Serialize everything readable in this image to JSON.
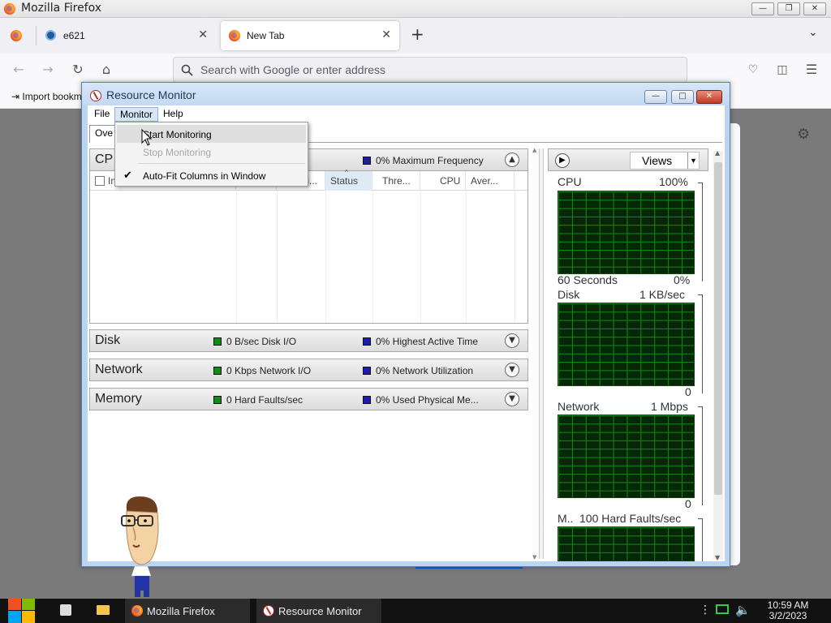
{
  "firefox": {
    "window_title": "Mozilla Firefox",
    "tabs": [
      {
        "label": "e621"
      },
      {
        "label": "New Tab"
      }
    ],
    "new_tab_symbol": "+",
    "url_placeholder": "Search with Google or enter address",
    "bookmark_label": "Import bookm"
  },
  "resource_monitor": {
    "title": "Resource Monitor",
    "menu": {
      "file": "File",
      "monitor": "Monitor",
      "help": "Help"
    },
    "tab_partial": "Ove",
    "dropdown": {
      "start": "Start Monitoring",
      "stop": "Stop Monitoring",
      "autofit": "Auto-Fit Columns in Window"
    },
    "cpu_section": {
      "name": "CP",
      "metric2": "0% Maximum Frequency",
      "columns": [
        "Ima",
        "PI",
        "Descri...",
        "Status",
        "Thre...",
        "CPU",
        "Aver..."
      ]
    },
    "sections": [
      {
        "name": "Disk",
        "metric1": "0 B/sec Disk I/O",
        "metric2": "0% Highest Active Time"
      },
      {
        "name": "Network",
        "metric1": "0 Kbps Network I/O",
        "metric2": "0% Network Utilization"
      },
      {
        "name": "Memory",
        "metric1": "0 Hard Faults/sec",
        "metric2": "0% Used Physical Me..."
      }
    ],
    "views_label": "Views",
    "graphs": [
      {
        "name": "CPU",
        "max": "100%",
        "time": "60 Seconds",
        "min": "0%"
      },
      {
        "name": "Disk",
        "max": "1 KB/sec",
        "min": "0"
      },
      {
        "name": "Network",
        "max": "1 Mbps",
        "min": "0"
      },
      {
        "name": "M..",
        "max": "100 Hard Faults/sec"
      }
    ]
  },
  "taskbar": {
    "apps": [
      {
        "label": "Mozilla Firefox"
      },
      {
        "label": "Resource Monitor"
      }
    ],
    "time": "10:59 AM",
    "date": "3/2/2023"
  },
  "colors": {
    "graph_bg": "#062706",
    "graph_grid": "#0f8c0f",
    "metric_green": "#138a13",
    "metric_blue": "#1c1ca8"
  }
}
